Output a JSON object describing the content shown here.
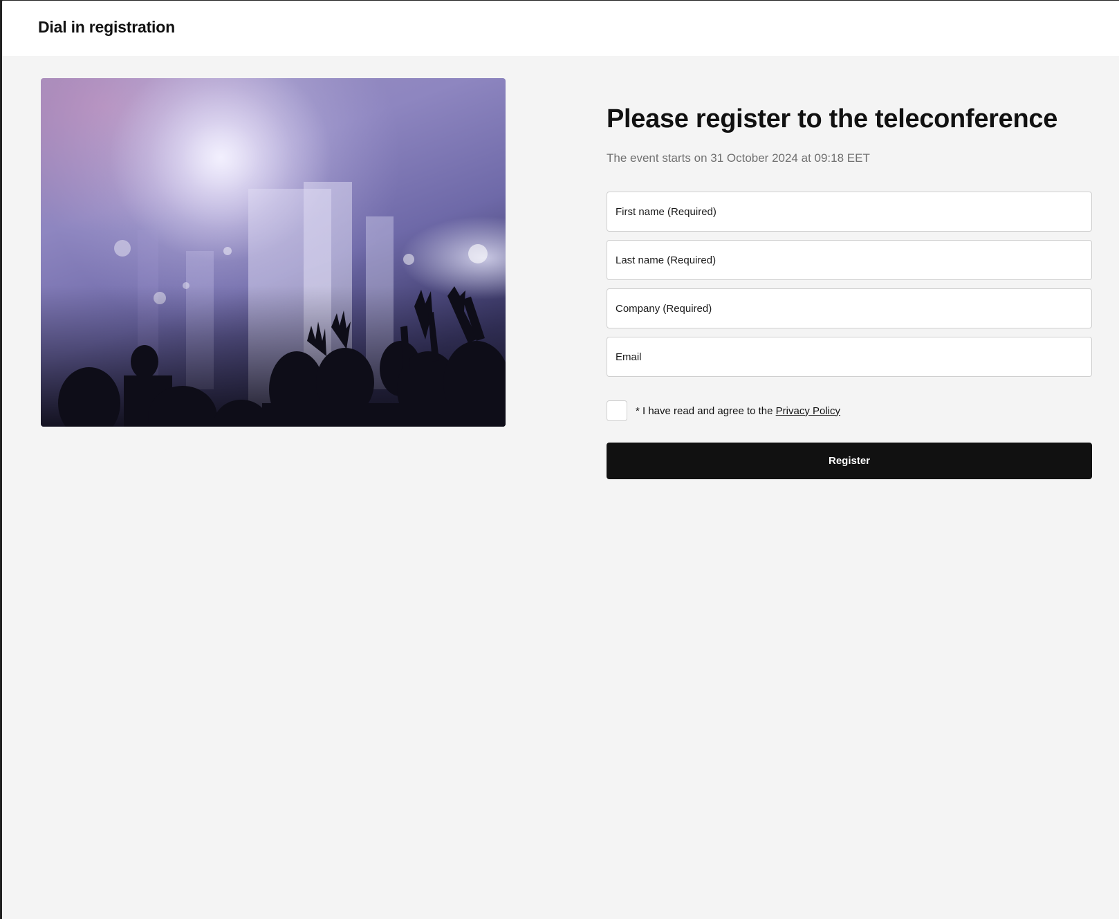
{
  "header": {
    "title": "Dial in registration"
  },
  "hero": {
    "icon": "concert-crowd-image"
  },
  "form": {
    "heading": "Please register to the teleconference",
    "subheading": "The event starts on 31 October 2024 at 09:18 EET",
    "first_name_placeholder": "First name (Required)",
    "last_name_placeholder": "Last name (Required)",
    "company_placeholder": "Company (Required)",
    "email_placeholder": "Email",
    "first_name_value": "",
    "last_name_value": "",
    "company_value": "",
    "email_value": "",
    "consent_checked": false,
    "consent_prefix": "* I have read and agree to the ",
    "privacy_link": "Privacy Policy",
    "register_label": "Register"
  },
  "colors": {
    "page_background": "#f4f4f4",
    "header_background": "#ffffff",
    "button_background": "#111111",
    "button_text": "#ffffff",
    "muted_text": "#707070"
  }
}
